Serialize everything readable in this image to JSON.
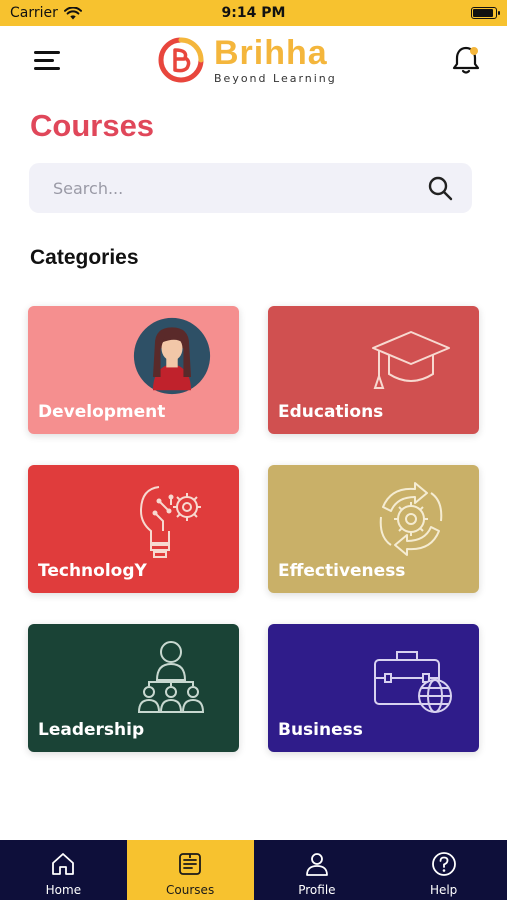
{
  "status_bar": {
    "carrier": "Carrier",
    "time": "9:14 PM",
    "battery_level": 0.9
  },
  "header": {
    "logo_title": "Brihha",
    "logo_subtitle": "Beyond Learning",
    "menu_icon": "hamburger-menu-icon",
    "notification_icon": "bell-icon"
  },
  "page": {
    "title": "Courses"
  },
  "search": {
    "placeholder": "Search...",
    "value": "",
    "icon": "search-icon"
  },
  "categories": {
    "title": "Categories",
    "items": [
      {
        "label": "Development",
        "color": "#f58f8f",
        "icon": "person-avatar-icon"
      },
      {
        "label": "Educations",
        "color": "#d05050",
        "icon": "graduation-cap-icon"
      },
      {
        "label": "TechnologY",
        "color": "#e03c3c",
        "icon": "lightbulb-gear-icon"
      },
      {
        "label": "Effectiveness",
        "color": "#c9b068",
        "icon": "gear-cycle-icon"
      },
      {
        "label": "Leadership",
        "color": "#1a4336",
        "icon": "team-leader-icon"
      },
      {
        "label": "Business",
        "color": "#2f1c8a",
        "icon": "briefcase-globe-icon"
      }
    ]
  },
  "tab_bar": {
    "active": "Courses",
    "items": [
      {
        "label": "Home",
        "icon": "home-icon"
      },
      {
        "label": "Courses",
        "icon": "book-icon"
      },
      {
        "label": "Profile",
        "icon": "person-icon"
      },
      {
        "label": "Help",
        "icon": "question-icon"
      }
    ]
  },
  "colors": {
    "accent_yellow": "#f7c22f",
    "title_red": "#e0475a",
    "tab_bar_bg": "#0e0f3a"
  }
}
